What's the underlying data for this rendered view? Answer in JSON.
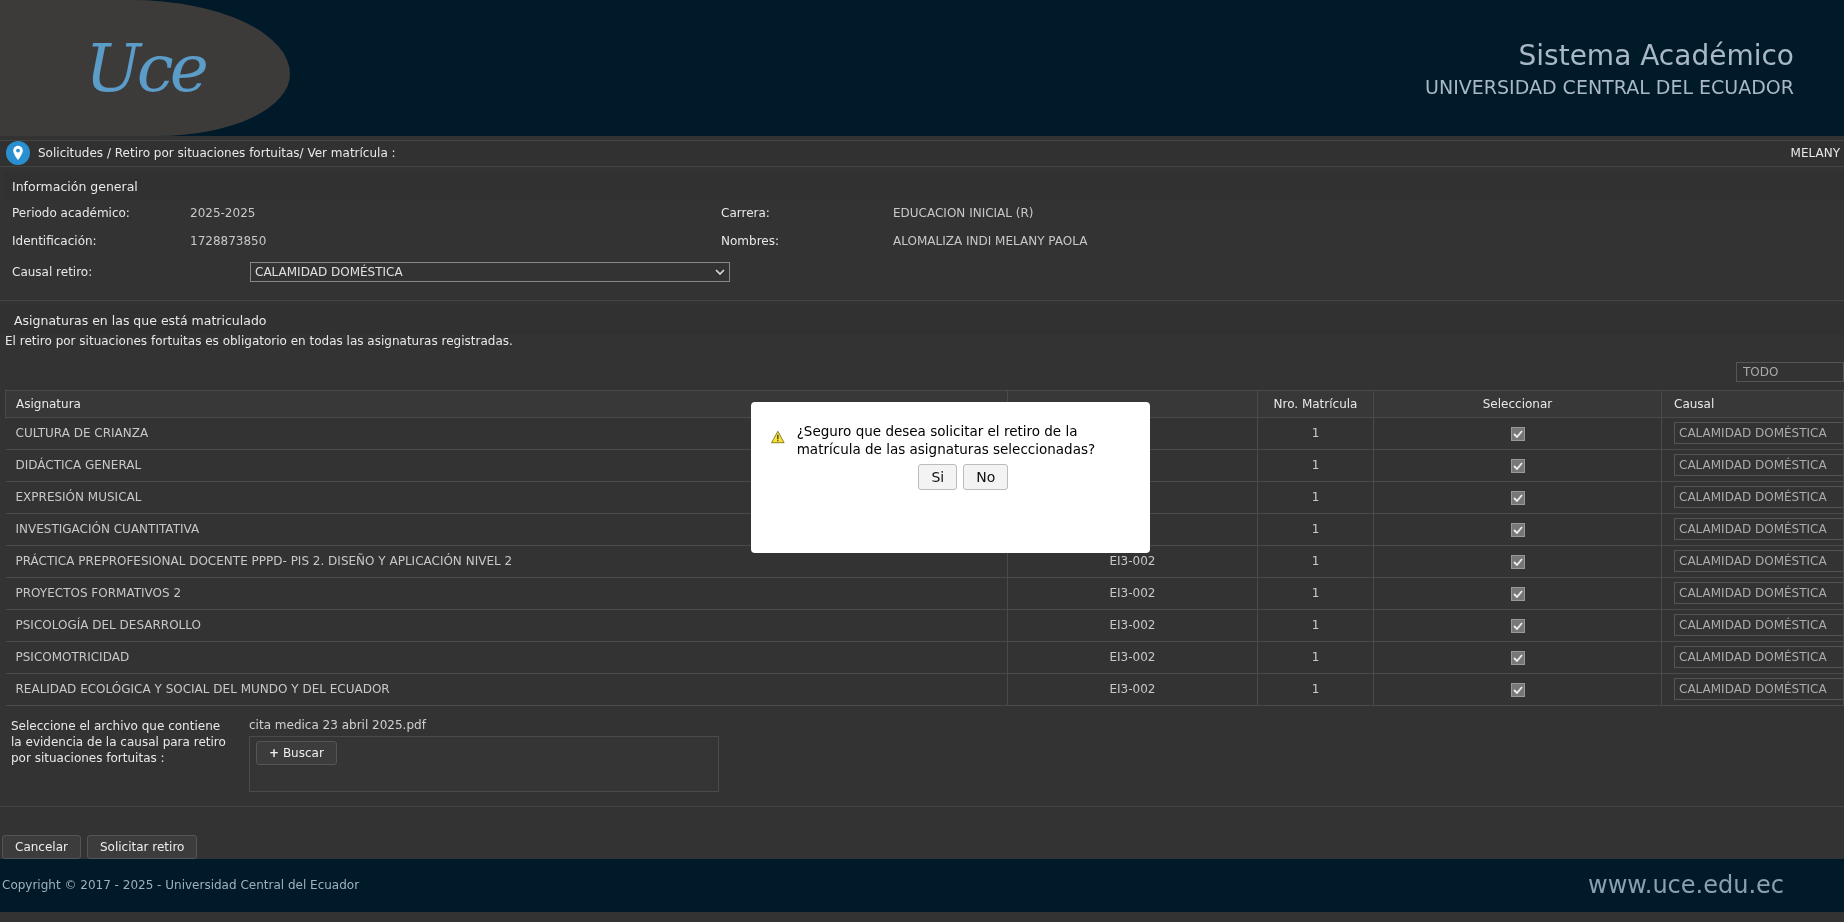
{
  "header": {
    "logo_text": "Uce",
    "system_title": "Sistema Académico",
    "university": "UNIVERSIDAD CENTRAL DEL ECUADOR"
  },
  "breadcrumb": {
    "path": "Solicitudes / Retiro por situaciones fortuitas/ Ver matrícula :",
    "user": "MELANY"
  },
  "general_info": {
    "title": "Información general",
    "fields": [
      {
        "label": "Periodo académico:",
        "value": "2025-2025"
      },
      {
        "label": "Carrera:",
        "value": "EDUCACION INICIAL (R)"
      },
      {
        "label": "Identificación:",
        "value": "1728873850"
      },
      {
        "label": "Nombres:",
        "value": "ALOMALIZA INDI MELANY PAOLA"
      }
    ],
    "causal": {
      "label": "Causal retiro:",
      "value": "CALAMIDAD DOMÉSTICA"
    }
  },
  "subjects": {
    "title": "Asignaturas en las que está matriculado",
    "note": "El retiro por situaciones fortuitas es obligatorio en todas las asignaturas registradas.",
    "filter": {
      "value": "TODO"
    },
    "table": {
      "columns": [
        "Asignatura",
        "",
        "Nro. Matrícula",
        "Seleccionar",
        "Causal"
      ],
      "rows": [
        {
          "subject": "CULTURA DE CRIANZA",
          "code": "",
          "number": "1",
          "checked": true,
          "causal": "CALAMIDAD DOMÉSTICA"
        },
        {
          "subject": "DIDÁCTICA GENERAL",
          "code": "",
          "number": "1",
          "checked": true,
          "causal": "CALAMIDAD DOMÉSTICA"
        },
        {
          "subject": "EXPRESIÓN MUSICAL",
          "code": "",
          "number": "1",
          "checked": true,
          "causal": "CALAMIDAD DOMÉSTICA"
        },
        {
          "subject": "INVESTIGACIÓN CUANTITATIVA",
          "code": "",
          "number": "1",
          "checked": true,
          "causal": "CALAMIDAD DOMÉSTICA"
        },
        {
          "subject": "PRÁCTICA PREPROFESIONAL DOCENTE PPPD- PIS 2. DISEÑO Y APLICACIÓN NIVEL 2",
          "code": "EI3-002",
          "number": "1",
          "checked": true,
          "causal": "CALAMIDAD DOMÉSTICA"
        },
        {
          "subject": "PROYECTOS FORMATIVOS 2",
          "code": "EI3-002",
          "number": "1",
          "checked": true,
          "causal": "CALAMIDAD DOMÉSTICA"
        },
        {
          "subject": "PSICOLOGÍA DEL DESARROLLO",
          "code": "EI3-002",
          "number": "1",
          "checked": true,
          "causal": "CALAMIDAD DOMÉSTICA"
        },
        {
          "subject": "PSICOMOTRICIDAD",
          "code": "EI3-002",
          "number": "1",
          "checked": true,
          "causal": "CALAMIDAD DOMÉSTICA"
        },
        {
          "subject": "REALIDAD ECOLÓGICA Y SOCIAL DEL MUNDO Y DEL ECUADOR",
          "code": "EI3-002",
          "number": "1",
          "checked": true,
          "causal": "CALAMIDAD DOMÉSTICA"
        }
      ]
    }
  },
  "evidence": {
    "label": "Seleccione el archivo que contiene la evidencia de la causal para retiro por situaciones fortuitas :",
    "file_name": "cita medica 23 abril 2025.pdf",
    "button": "Buscar",
    "button_icon": "+"
  },
  "actions": [
    "Cancelar",
    "Solicitar retiro"
  ],
  "footer": {
    "copyright": "Copyright © 2017 - 2025 - Universidad Central del Ecuador",
    "website": "www.uce.edu.ec"
  },
  "dialog": {
    "message": "¿Seguro que desea solicitar el retiro de la matrícula de las asignaturas seleccionadas?",
    "buttons": [
      "Si",
      "No"
    ]
  }
}
